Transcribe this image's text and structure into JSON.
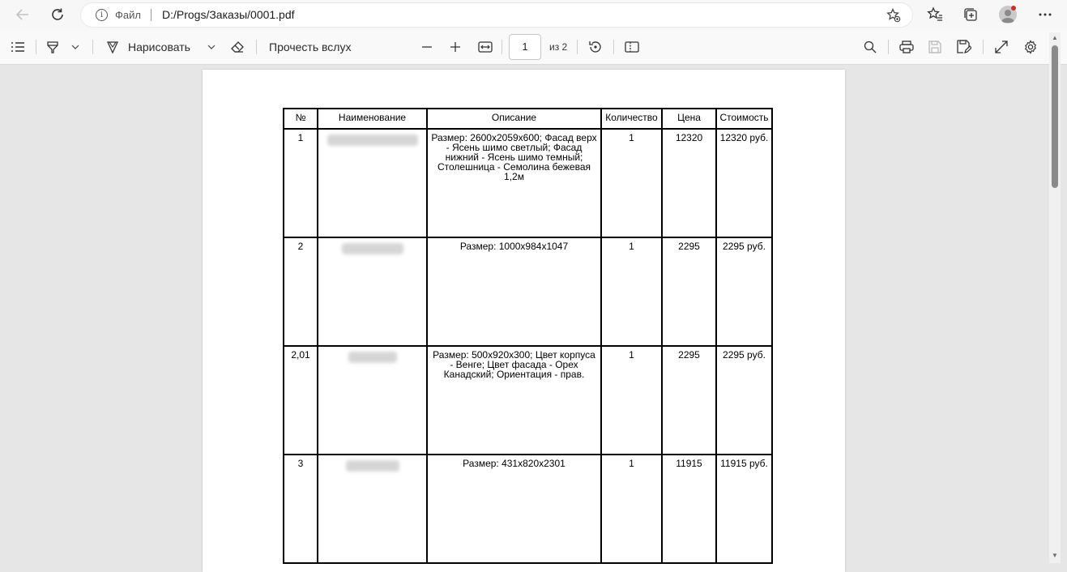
{
  "browser": {
    "scheme_label": "Файл",
    "url": "D:/Progs/Заказы/0001.pdf",
    "icons": [
      "back-arrow-icon",
      "refresh-icon",
      "info-icon",
      "add-favorite-icon",
      "favorites-icon",
      "collections-icon",
      "profile-avatar",
      "more-icon"
    ]
  },
  "pdf_toolbar": {
    "draw_label": "Нарисовать",
    "read_aloud_label": "Прочесть вслух",
    "page_current": "1",
    "page_total": "из 2"
  },
  "table": {
    "headers": [
      "№",
      "Наименование",
      "Описание",
      "Количество",
      "Цена",
      "Стоимость"
    ],
    "rows": [
      {
        "num": "1",
        "description": "Размер: 2600x2059x600; Фасад верх - Ясень шимо светлый; Фасад нижний - Ясень шимо темный; Столешница - Семолина бежевая 1,2м",
        "qty": "1",
        "price": "12320",
        "cost": "12320 руб."
      },
      {
        "num": "2",
        "description": "Размер: 1000x984x1047",
        "qty": "1",
        "price": "2295",
        "cost": "2295 руб."
      },
      {
        "num": "2,01",
        "description": "Размер: 500x920x300; Цвет корпуса - Венге; Цвет фасада - Орех Канадский; Ориентация - прав.",
        "qty": "1",
        "price": "2295",
        "cost": "2295 руб."
      },
      {
        "num": "3",
        "description": "Размер: 431x820x2301",
        "qty": "1",
        "price": "11915",
        "cost": "11915 руб."
      }
    ]
  },
  "colors": {
    "browser_bg": "#f7f7f7",
    "viewer_bg": "#e6e6e6",
    "page_bg": "#ffffff",
    "notification_dot": "#d12c2c"
  }
}
